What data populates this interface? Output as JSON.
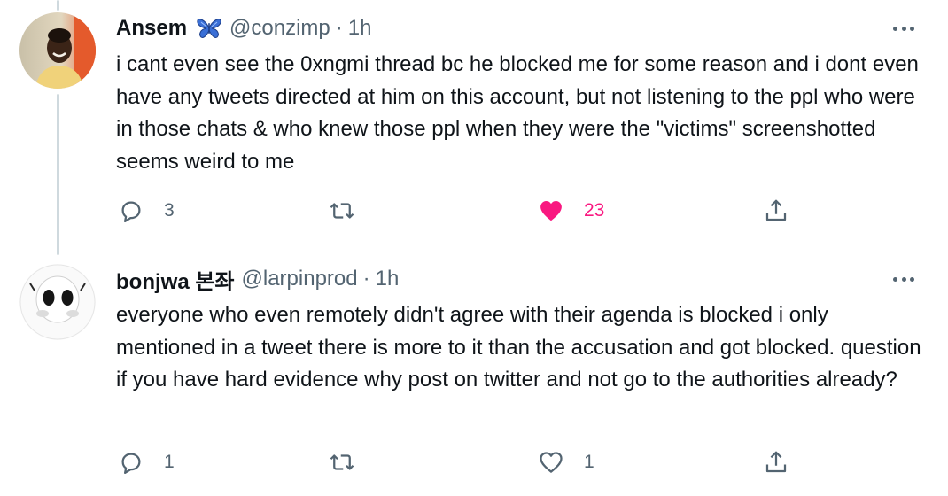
{
  "tweets": [
    {
      "name": "Ansem",
      "badge_icon": "butterfly-icon",
      "handle": "@conzimp",
      "separator": "·",
      "time": "1h",
      "text": "i cant even see the 0xngmi thread bc he blocked me for some reason and i dont even have any tweets directed at him on this account, but not listening to the ppl who were in those chats & who knew those ppl when they were the \"victims\" screenshotted seems weird to me",
      "reply_count": "3",
      "retweet_count": "",
      "like_count": "23",
      "liked": true
    },
    {
      "name": "bonjwa 본좌",
      "handle": "@larpinprod",
      "separator": "·",
      "time": "1h",
      "text": "everyone who even remotely didn't agree with their agenda is blocked i only mentioned in a tweet there is more to it than the accusation and got blocked. question if you have hard evidence why post on twitter and not go to the authorities already?",
      "reply_count": "1",
      "retweet_count": "",
      "like_count": "1",
      "liked": false
    }
  ],
  "colors": {
    "text": "#0f1419",
    "muted": "#536471",
    "like_active": "#f91880",
    "thread_line": "#cfd9de",
    "butterfly": "#3a6fd6"
  }
}
